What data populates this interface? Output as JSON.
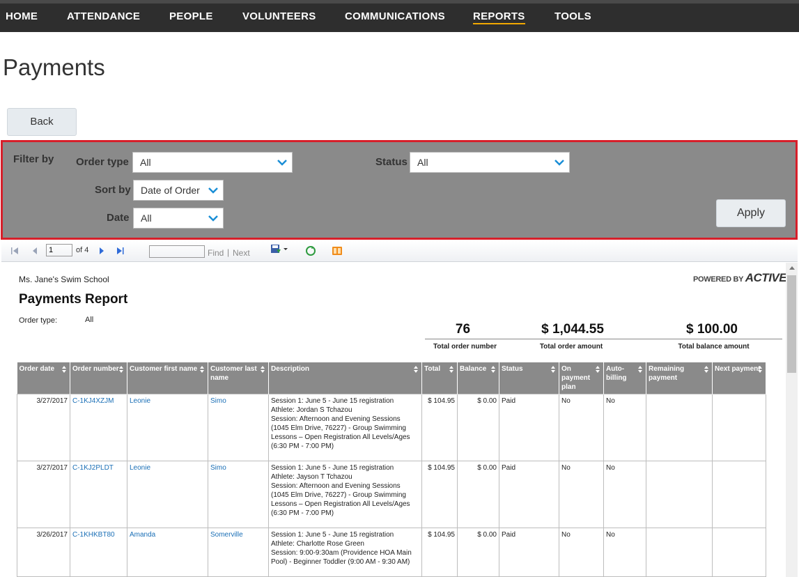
{
  "nav": {
    "items": [
      "HOME",
      "ATTENDANCE",
      "PEOPLE",
      "VOLUNTEERS",
      "COMMUNICATIONS",
      "REPORTS",
      "TOOLS"
    ],
    "active": "REPORTS"
  },
  "page": {
    "title": "Payments",
    "back_label": "Back"
  },
  "filters": {
    "filter_by_label": "Filter by",
    "order_type_label": "Order type",
    "order_type_value": "All",
    "status_label": "Status",
    "status_value": "All",
    "sort_by_label": "Sort by",
    "sort_by_value": "Date of Order",
    "date_label": "Date",
    "date_value": "All",
    "apply_label": "Apply"
  },
  "toolbar": {
    "page_value": "1",
    "of_text": "of 4",
    "find_label": "Find",
    "separator": "|",
    "next_label": "Next"
  },
  "report": {
    "school": "Ms. Jane's Swim School",
    "powered_by": "POWERED BY",
    "brand": "ACTIVE",
    "title": "Payments Report",
    "order_type_label": "Order type:",
    "order_type_value": "All",
    "summary": {
      "total_orders_value": "76",
      "total_orders_label": "Total order number",
      "total_amount_value": "$ 1,044.55",
      "total_amount_label": "Total order amount",
      "total_balance_value": "$ 100.00",
      "total_balance_label": "Total balance amount"
    },
    "columns": [
      "Order date",
      "Order number",
      "Customer first name",
      "Customer last name",
      "Description",
      "Total",
      "Balance",
      "Status",
      "On payment plan",
      "Auto-billing",
      "Remaining payment",
      "Next payment"
    ],
    "rows": [
      {
        "date": "3/27/2017",
        "order": "C-1KJ4XZJM",
        "first": "Leonie",
        "last": "Simo",
        "desc": [
          "Session 1: June 5 - June 15 registration",
          "Athlete: Jordan S Tchazou",
          "Session: Afternoon and Evening Sessions (1045 Elm Drive, 76227) - Group Swimming Lessons – Open Registration  All Levels/Ages (6:30 PM - 7:00 PM)"
        ],
        "total": "$ 104.95",
        "balance": "$ 0.00",
        "status": "Paid",
        "plan": "No",
        "auto": "No"
      },
      {
        "date": "3/27/2017",
        "order": "C-1KJ2PLDT",
        "first": "Leonie",
        "last": "Simo",
        "desc": [
          "Session 1: June 5 - June 15 registration",
          "Athlete: Jayson T Tchazou",
          "Session: Afternoon and Evening Sessions (1045 Elm Drive, 76227) - Group Swimming Lessons – Open Registration  All Levels/Ages (6:30 PM - 7:00 PM)"
        ],
        "total": "$ 104.95",
        "balance": "$ 0.00",
        "status": "Paid",
        "plan": "No",
        "auto": "No"
      },
      {
        "date": "3/26/2017",
        "order": "C-1KHKBT80",
        "first": "Amanda",
        "last": "Somerville",
        "desc": [
          "Session 1: June 5 - June 15 registration",
          "Athlete: Charlotte Rose Green",
          "Session: 9:00-9:30am (Providence HOA Main Pool) - Beginner Toddler (9:00 AM - 9:30 AM)"
        ],
        "total": "$ 104.95",
        "balance": "$ 0.00",
        "status": "Paid",
        "plan": "No",
        "auto": "No"
      }
    ]
  }
}
